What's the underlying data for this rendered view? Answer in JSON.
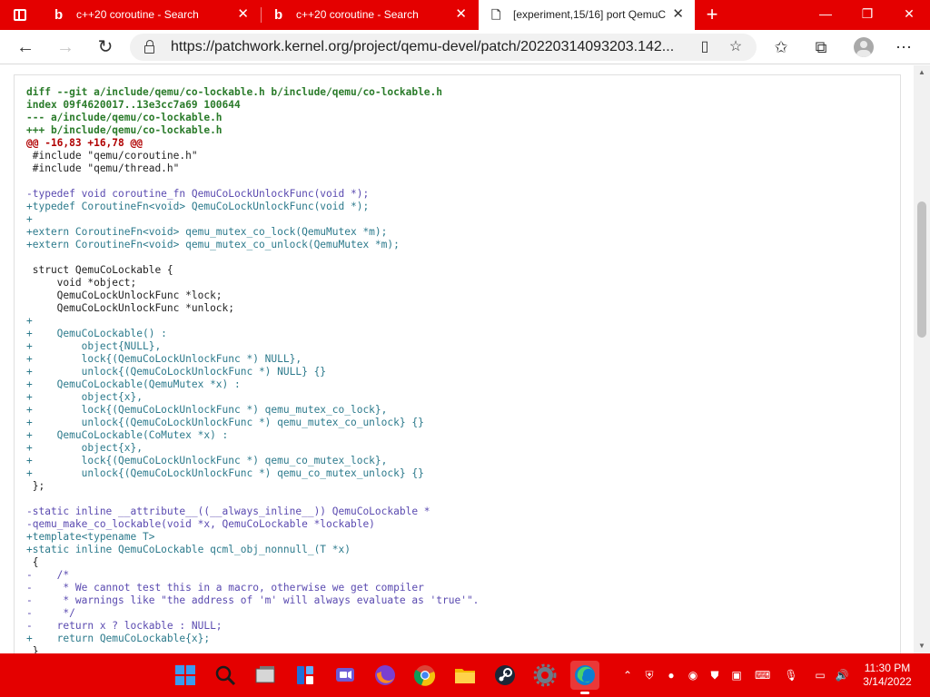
{
  "browser": {
    "tabs": [
      {
        "title": "c++20 coroutine - Search",
        "favicon": "bing-icon",
        "active": false
      },
      {
        "title": "c++20 coroutine - Search",
        "favicon": "bing-icon",
        "active": false
      },
      {
        "title": "[experiment,15/16] port QemuCo",
        "favicon": "page-icon",
        "active": true
      }
    ],
    "new_tab_label": "+",
    "window_controls": {
      "minimize": "—",
      "maximize": "❐",
      "close": "✕"
    },
    "url": "https://patchwork.kernel.org/project/qemu-devel/patch/20220314093203.142..."
  },
  "diff_lines": [
    {
      "t": "hdr",
      "text": "diff --git a/include/qemu/co-lockable.h b/include/qemu/co-lockable.h"
    },
    {
      "t": "hdr",
      "text": "index 09f4620017..13e3cc7a69 100644"
    },
    {
      "t": "hdr",
      "text": "--- a/include/qemu/co-lockable.h"
    },
    {
      "t": "hdr",
      "text": "+++ b/include/qemu/co-lockable.h"
    },
    {
      "t": "hunk",
      "text": "@@ -16,83 +16,78 @@"
    },
    {
      "t": "ctx",
      "text": " #include \"qemu/coroutine.h\""
    },
    {
      "t": "ctx",
      "text": " #include \"qemu/thread.h\""
    },
    {
      "t": "ctx",
      "text": ""
    },
    {
      "t": "del",
      "text": "-typedef void coroutine_fn QemuCoLockUnlockFunc(void *);"
    },
    {
      "t": "add",
      "text": "+typedef CoroutineFn<void> QemuCoLockUnlockFunc(void *);"
    },
    {
      "t": "add",
      "text": "+"
    },
    {
      "t": "add",
      "text": "+extern CoroutineFn<void> qemu_mutex_co_lock(QemuMutex *m);"
    },
    {
      "t": "add",
      "text": "+extern CoroutineFn<void> qemu_mutex_co_unlock(QemuMutex *m);"
    },
    {
      "t": "ctx",
      "text": ""
    },
    {
      "t": "ctx",
      "text": " struct QemuCoLockable {"
    },
    {
      "t": "ctx",
      "text": "     void *object;"
    },
    {
      "t": "ctx",
      "text": "     QemuCoLockUnlockFunc *lock;"
    },
    {
      "t": "ctx",
      "text": "     QemuCoLockUnlockFunc *unlock;"
    },
    {
      "t": "add",
      "text": "+"
    },
    {
      "t": "add",
      "text": "+    QemuCoLockable() :"
    },
    {
      "t": "add",
      "text": "+        object{NULL},"
    },
    {
      "t": "add",
      "text": "+        lock{(QemuCoLockUnlockFunc *) NULL},"
    },
    {
      "t": "add",
      "text": "+        unlock{(QemuCoLockUnlockFunc *) NULL} {}"
    },
    {
      "t": "add",
      "text": "+    QemuCoLockable(QemuMutex *x) :"
    },
    {
      "t": "add",
      "text": "+        object{x},"
    },
    {
      "t": "add",
      "text": "+        lock{(QemuCoLockUnlockFunc *) qemu_mutex_co_lock},"
    },
    {
      "t": "add",
      "text": "+        unlock{(QemuCoLockUnlockFunc *) qemu_mutex_co_unlock} {}"
    },
    {
      "t": "add",
      "text": "+    QemuCoLockable(CoMutex *x) :"
    },
    {
      "t": "add",
      "text": "+        object{x},"
    },
    {
      "t": "add",
      "text": "+        lock{(QemuCoLockUnlockFunc *) qemu_co_mutex_lock},"
    },
    {
      "t": "add",
      "text": "+        unlock{(QemuCoLockUnlockFunc *) qemu_co_mutex_unlock} {}"
    },
    {
      "t": "ctx",
      "text": " };"
    },
    {
      "t": "ctx",
      "text": ""
    },
    {
      "t": "del",
      "text": "-static inline __attribute__((__always_inline__)) QemuCoLockable *"
    },
    {
      "t": "del",
      "text": "-qemu_make_co_lockable(void *x, QemuCoLockable *lockable)"
    },
    {
      "t": "add",
      "text": "+template<typename T>"
    },
    {
      "t": "add",
      "text": "+static inline QemuCoLockable qcml_obj_nonnull_(T *x)"
    },
    {
      "t": "ctx",
      "text": " {"
    },
    {
      "t": "del",
      "text": "-    /*"
    },
    {
      "t": "del",
      "text": "-     * We cannot test this in a macro, otherwise we get compiler"
    },
    {
      "t": "del",
      "text": "-     * warnings like \"the address of 'm' will always evaluate as 'true'\"."
    },
    {
      "t": "del",
      "text": "-     */"
    },
    {
      "t": "del",
      "text": "-    return x ? lockable : NULL;"
    },
    {
      "t": "add",
      "text": "+    return QemuCoLockable{x};"
    },
    {
      "t": "ctx",
      "text": " }"
    }
  ],
  "taskbar": {
    "apps": [
      "windows-start-icon",
      "search-icon",
      "task-view-icon",
      "widgets-icon",
      "chat-icon",
      "firefox-icon",
      "chrome-icon",
      "file-explorer-icon",
      "steam-icon",
      "settings-icon",
      "edge-icon"
    ],
    "time": "11:30 PM",
    "date": "3/14/2022"
  },
  "colors": {
    "accent": "#e40000",
    "diff_header": "#2a7b2a",
    "diff_hunk": "#b00000",
    "diff_add": "#2c7a8c",
    "diff_del": "#5a4ab0"
  }
}
